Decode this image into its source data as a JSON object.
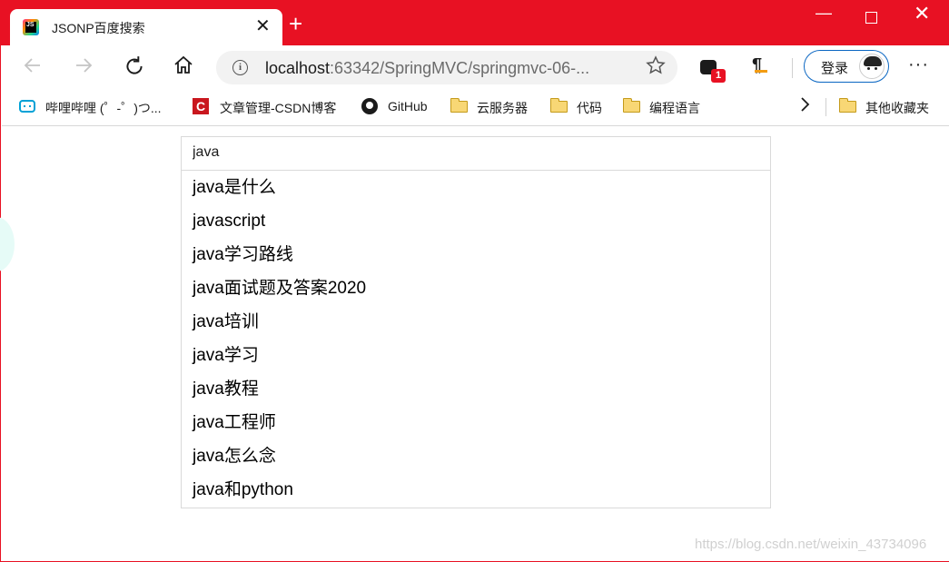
{
  "window": {
    "tab_title": "JSONP百度搜索",
    "tab_favicon_text": "JS",
    "close_tab": "✕",
    "new_tab": "+",
    "minimize": "—",
    "close": "✕"
  },
  "toolbar": {
    "url_host": "localhost",
    "url_rest": ":63342/SpringMVC/springmvc-06-...",
    "extension_badge": "1",
    "extension2_glyph": "¶",
    "login_label": "登录",
    "more": "···"
  },
  "bookmarks": {
    "items": [
      {
        "label": "哔哩哔哩 (゜-゜)つ...",
        "icon": "bilibili-icon"
      },
      {
        "label": "文章管理-CSDN博客",
        "icon": "csdn-icon"
      },
      {
        "label": "GitHub",
        "icon": "github-icon"
      },
      {
        "label": "云服务器",
        "icon": "folder-icon"
      },
      {
        "label": "代码",
        "icon": "folder-icon"
      },
      {
        "label": "编程语言",
        "icon": "folder-icon"
      }
    ],
    "other_label": "其他收藏夹"
  },
  "search": {
    "value": "java",
    "suggestions": [
      "java是什么",
      "javascript",
      "java学习路线",
      "java面试题及答案2020",
      "java培训",
      "java学习",
      "java教程",
      "java工程师",
      "java怎么念",
      "java和python"
    ]
  },
  "watermark": "https://blog.csdn.net/weixin_43734096",
  "colors": {
    "titlebar": "#e81123",
    "login_border": "#0a66c2"
  }
}
